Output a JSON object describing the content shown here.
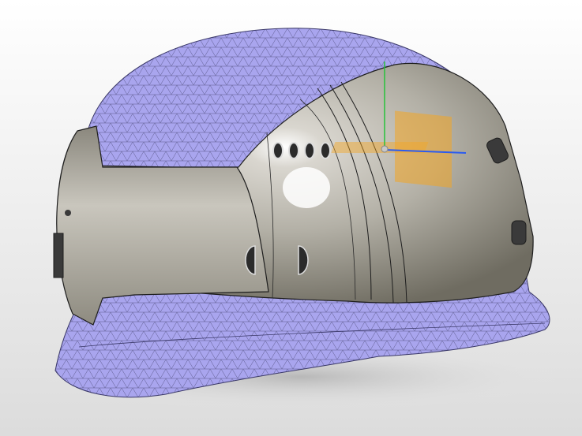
{
  "viewport": {
    "background_top": "#ffffff",
    "background_bottom": "#dcdcdc",
    "shadow_color": "#b8b8b8"
  },
  "helmet": {
    "mesh_fill": "#a9a5ee",
    "mesh_line": "#5c5a8c",
    "shell_light": "#ececec",
    "shell_mid": "#b9b6ad",
    "shell_dark": "#6f6c61",
    "edge_line": "#1e1e1e",
    "vent_count_top_row": 4,
    "side_cutouts": 2
  },
  "gizmo": {
    "x_axis_color": "#2b5bf0",
    "y_axis_color": "#26c23a",
    "plane_color": "#f3a624",
    "origin_color": "#c8c8c8"
  }
}
